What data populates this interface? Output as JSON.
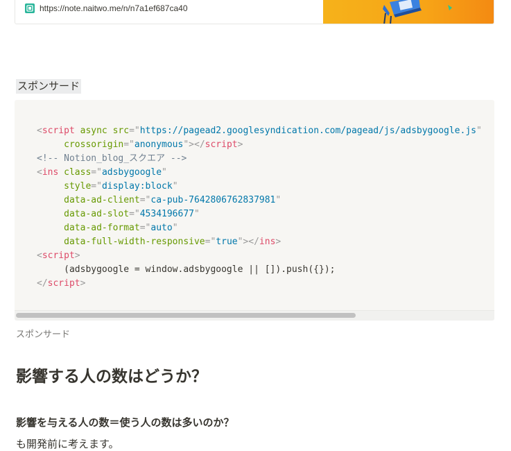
{
  "bookmark": {
    "url": "https://note.naitwo.me/n/n7a1ef687ca40",
    "favicon_icon": "note-favicon-icon"
  },
  "sponsor_heading": "スポンサード",
  "code": {
    "lines": [
      [
        [
          "punct",
          "<"
        ],
        [
          "tag",
          "script"
        ],
        [
          "plain",
          " "
        ],
        [
          "attr",
          "async"
        ],
        [
          "plain",
          " "
        ],
        [
          "attr",
          "src"
        ],
        [
          "punct",
          "=\""
        ],
        [
          "val",
          "https://pagead2.googlesyndication.com/pagead/js/adsbygoogle.js"
        ],
        [
          "punct",
          "\""
        ]
      ],
      [
        [
          "plain",
          "     "
        ],
        [
          "attr",
          "crossorigin"
        ],
        [
          "punct",
          "=\""
        ],
        [
          "val",
          "anonymous"
        ],
        [
          "punct",
          "\"></"
        ],
        [
          "tag",
          "script"
        ],
        [
          "punct",
          ">"
        ]
      ],
      [
        [
          "comment",
          "<!-- Notion_blog_スクエア -->"
        ]
      ],
      [
        [
          "punct",
          "<"
        ],
        [
          "tag",
          "ins"
        ],
        [
          "plain",
          " "
        ],
        [
          "attr",
          "class"
        ],
        [
          "punct",
          "=\""
        ],
        [
          "val",
          "adsbygoogle"
        ],
        [
          "punct",
          "\""
        ]
      ],
      [
        [
          "plain",
          "     "
        ],
        [
          "attr",
          "style"
        ],
        [
          "punct",
          "=\""
        ],
        [
          "val",
          "display:block"
        ],
        [
          "punct",
          "\""
        ]
      ],
      [
        [
          "plain",
          "     "
        ],
        [
          "attr",
          "data-ad-client"
        ],
        [
          "punct",
          "=\""
        ],
        [
          "val",
          "ca-pub-7642806762837981"
        ],
        [
          "punct",
          "\""
        ]
      ],
      [
        [
          "plain",
          "     "
        ],
        [
          "attr",
          "data-ad-slot"
        ],
        [
          "punct",
          "=\""
        ],
        [
          "val",
          "4534196677"
        ],
        [
          "punct",
          "\""
        ]
      ],
      [
        [
          "plain",
          "     "
        ],
        [
          "attr",
          "data-ad-format"
        ],
        [
          "punct",
          "=\""
        ],
        [
          "val",
          "auto"
        ],
        [
          "punct",
          "\""
        ]
      ],
      [
        [
          "plain",
          "     "
        ],
        [
          "attr",
          "data-full-width-responsive"
        ],
        [
          "punct",
          "=\""
        ],
        [
          "val",
          "true"
        ],
        [
          "punct",
          "\"></"
        ],
        [
          "tag",
          "ins"
        ],
        [
          "punct",
          ">"
        ]
      ],
      [
        [
          "punct",
          "<"
        ],
        [
          "tag",
          "script"
        ],
        [
          "punct",
          ">"
        ]
      ],
      [
        [
          "plain",
          "     (adsbygoogle = window.adsbygoogle || []).push({});"
        ]
      ],
      [
        [
          "punct",
          "</"
        ],
        [
          "tag",
          "script"
        ],
        [
          "punct",
          ">"
        ]
      ]
    ]
  },
  "caption": "スポンサード",
  "heading2": "影響する人の数はどうか？",
  "heading3": "影響を与える人の数＝使う人の数は多いのか？",
  "paragraph": "も開発前に考えます。"
}
